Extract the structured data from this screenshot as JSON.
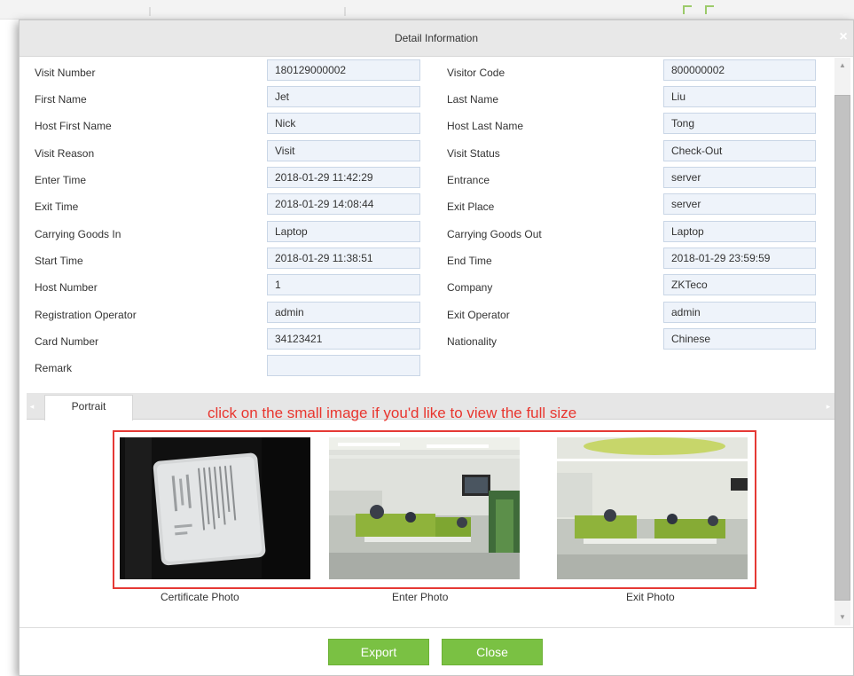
{
  "dialog": {
    "title": "Detail Information",
    "close_glyph": "×"
  },
  "fields": [
    {
      "left_label": "Visit Number",
      "left_value": "180129000002",
      "right_label": "Visitor Code",
      "right_value": "800000002"
    },
    {
      "left_label": "First Name",
      "left_value": "Jet",
      "right_label": "Last Name",
      "right_value": "Liu"
    },
    {
      "left_label": "Host First Name",
      "left_value": "Nick",
      "right_label": "Host Last Name",
      "right_value": "Tong"
    },
    {
      "left_label": "Visit Reason",
      "left_value": "Visit",
      "right_label": "Visit Status",
      "right_value": "Check-Out"
    },
    {
      "left_label": "Enter Time",
      "left_value": "2018-01-29 11:42:29",
      "right_label": "Entrance",
      "right_value": "server"
    },
    {
      "left_label": "Exit Time",
      "left_value": "2018-01-29 14:08:44",
      "right_label": "Exit Place",
      "right_value": "server"
    },
    {
      "left_label": "Carrying Goods In",
      "left_value": "Laptop",
      "right_label": "Carrying Goods Out",
      "right_value": "Laptop"
    },
    {
      "left_label": "Start Time",
      "left_value": "2018-01-29 11:38:51",
      "right_label": "End Time",
      "right_value": "2018-01-29 23:59:59"
    },
    {
      "left_label": "Host Number",
      "left_value": "1",
      "right_label": "Company",
      "right_value": "ZKTeco"
    },
    {
      "left_label": "Registration Operator",
      "left_value": "admin",
      "right_label": "Exit Operator",
      "right_value": "admin"
    },
    {
      "left_label": "Card Number",
      "left_value": "34123421",
      "right_label": "Nationality",
      "right_value": "Chinese"
    }
  ],
  "remark": {
    "label": "Remark",
    "value": ""
  },
  "tabs": [
    {
      "label": "Portrait"
    }
  ],
  "hint_text": "click on the small image if you'd like to view the full size",
  "photos": [
    {
      "caption": "Certificate Photo"
    },
    {
      "caption": "Enter Photo"
    },
    {
      "caption": "Exit Photo"
    }
  ],
  "buttons": {
    "export": "Export",
    "close": "Close"
  },
  "colors": {
    "accent_green": "#7ac143",
    "hint_red": "#e8362f",
    "frame_red": "#e53935",
    "field_bg": "#eef3fa",
    "field_border": "#c9d6e6"
  },
  "icons": {
    "scroll_up": "▲",
    "scroll_down": "▼",
    "tab_left": "◂",
    "tab_right": "▸"
  }
}
